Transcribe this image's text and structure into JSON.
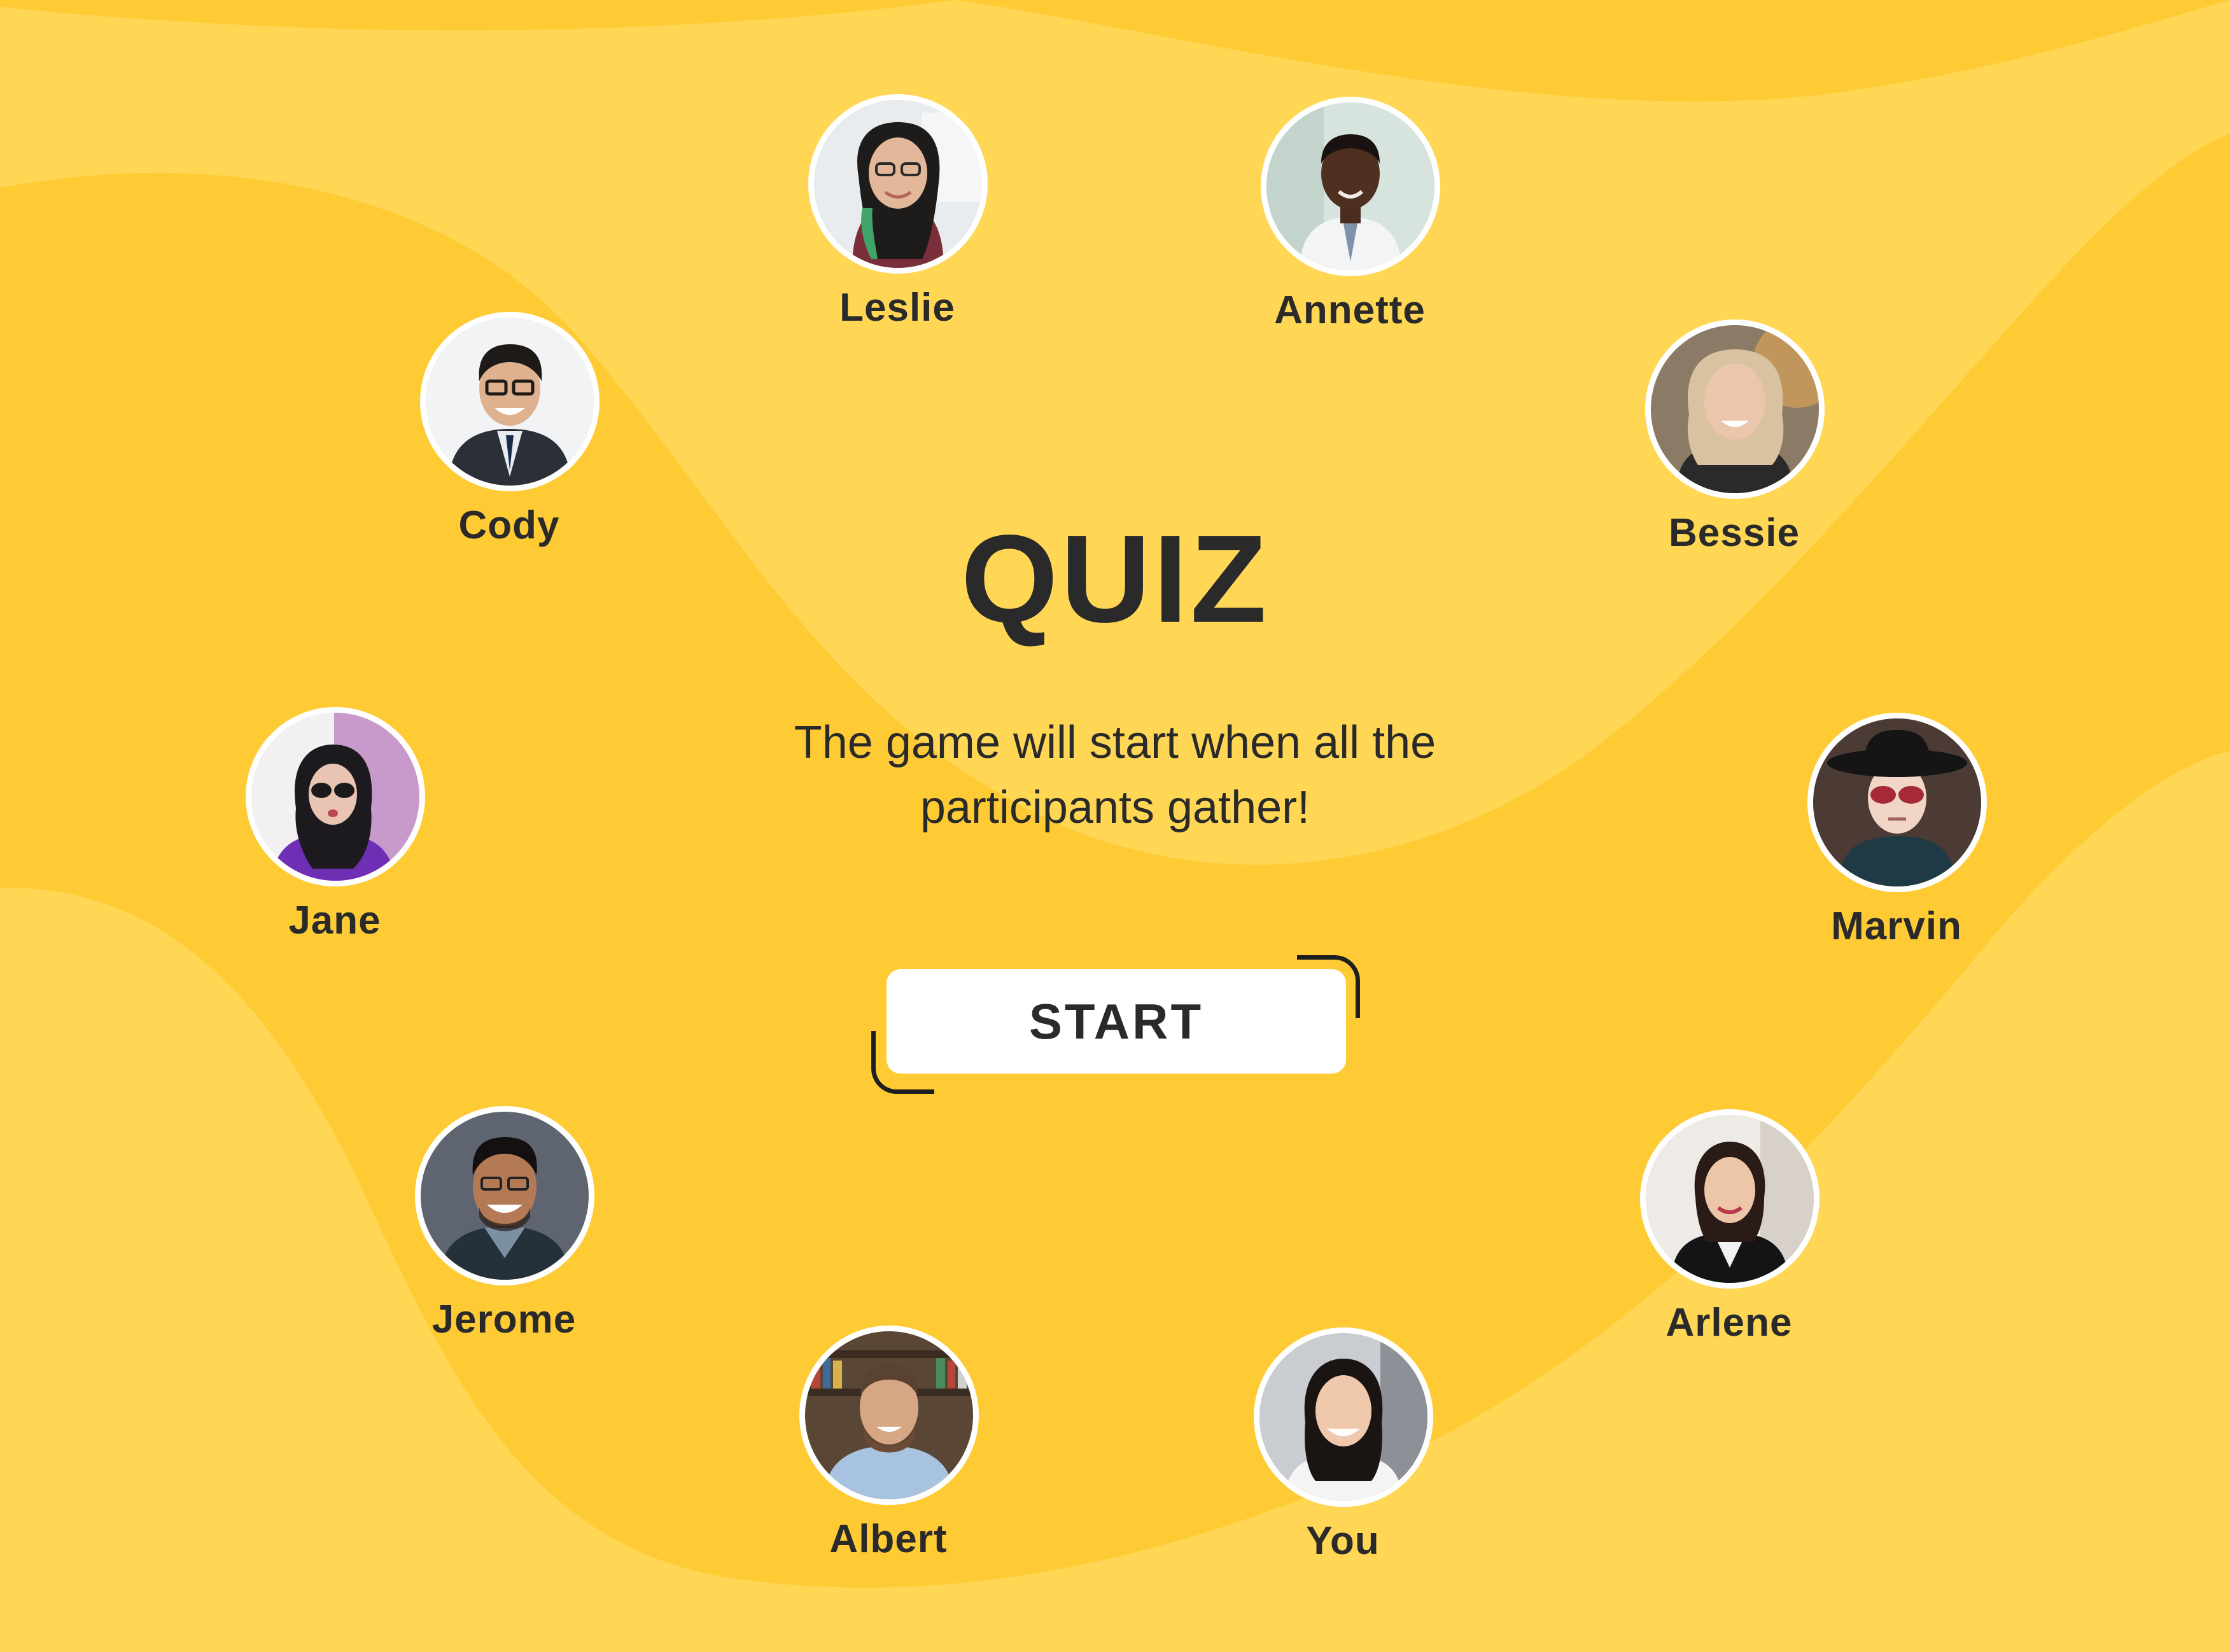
{
  "colors": {
    "background": "#FFCB35",
    "wave_light": "#FFD754",
    "text": "#2A2A2A",
    "button_bg": "#FFFFFF",
    "avatar_ring": "#FFFFFF"
  },
  "quiz": {
    "title": "QUIZ",
    "subtitle_line1": "The game will start when all the",
    "subtitle_line2": "participants gather!",
    "start_label": "START"
  },
  "participants": [
    {
      "name": "Leslie",
      "icon": "avatar-photo"
    },
    {
      "name": "Annette",
      "icon": "avatar-photo"
    },
    {
      "name": "Cody",
      "icon": "avatar-photo"
    },
    {
      "name": "Bessie",
      "icon": "avatar-photo"
    },
    {
      "name": "Jane",
      "icon": "avatar-photo"
    },
    {
      "name": "Marvin",
      "icon": "avatar-photo"
    },
    {
      "name": "Jerome",
      "icon": "avatar-photo"
    },
    {
      "name": "Arlene",
      "icon": "avatar-photo"
    },
    {
      "name": "Albert",
      "icon": "avatar-photo"
    },
    {
      "name": "You",
      "icon": "avatar-photo"
    }
  ]
}
